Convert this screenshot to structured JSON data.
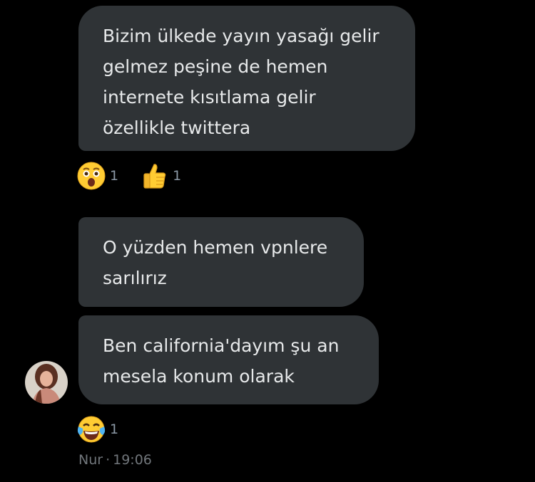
{
  "messages": [
    {
      "lines": [
        "Bizim ülkede yayın yasağı gelir",
        "gelmez peşine de hemen",
        "internete kısıtlama gelir",
        "özellikle twittera"
      ],
      "reactions": [
        {
          "emoji": "astonished-face",
          "count": "1"
        },
        {
          "emoji": "thumbs-up",
          "count": "1"
        }
      ]
    },
    {
      "lines": [
        "O yüzden hemen vpnlere",
        "sarılırız"
      ]
    },
    {
      "lines": [
        "Ben california'dayım şu an",
        "mesela konum olarak"
      ],
      "reactions": [
        {
          "emoji": "face-with-tears-of-joy",
          "count": "1"
        }
      ]
    }
  ],
  "sender": {
    "name": "Nur",
    "time": "19:06"
  },
  "colors": {
    "background": "#000000",
    "bubble": "#2f3336",
    "text": "#e7e9ea",
    "meta": "#71767b"
  }
}
